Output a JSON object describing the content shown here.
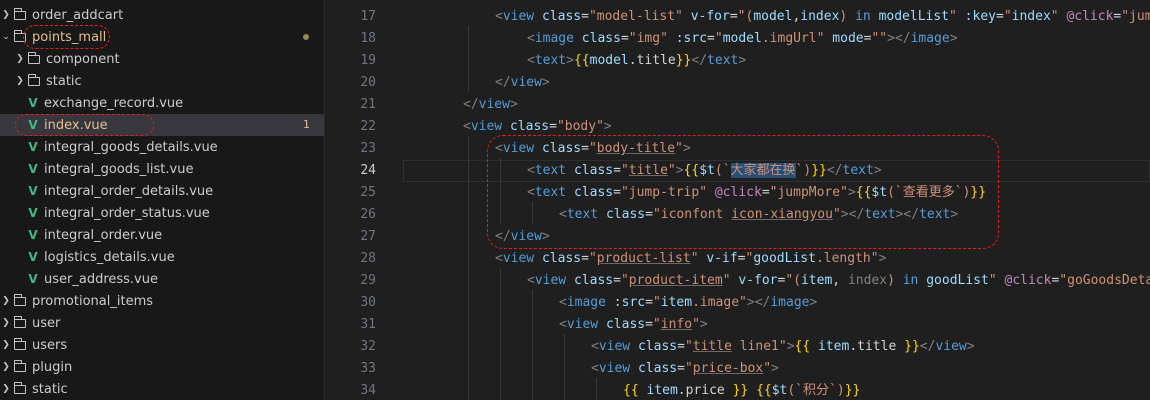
{
  "explorer": {
    "items": [
      {
        "label": "order_addcart",
        "kind": "folder",
        "expanded": false
      },
      {
        "label": "points_mall",
        "kind": "folder",
        "expanded": true,
        "modified": true
      },
      {
        "label": "component",
        "kind": "folder",
        "expanded": false
      },
      {
        "label": "static",
        "kind": "folder",
        "expanded": false
      },
      {
        "label": "exchange_record.vue",
        "kind": "vue"
      },
      {
        "label": "index.vue",
        "kind": "vue",
        "selected": true,
        "problem_count": "1"
      },
      {
        "label": "integral_goods_details.vue",
        "kind": "vue"
      },
      {
        "label": "integral_goods_list.vue",
        "kind": "vue"
      },
      {
        "label": "integral_order_details.vue",
        "kind": "vue"
      },
      {
        "label": "integral_order_status.vue",
        "kind": "vue"
      },
      {
        "label": "integral_order.vue",
        "kind": "vue"
      },
      {
        "label": "logistics_details.vue",
        "kind": "vue"
      },
      {
        "label": "user_address.vue",
        "kind": "vue"
      },
      {
        "label": "promotional_items",
        "kind": "folder",
        "expanded": false
      },
      {
        "label": "user",
        "kind": "folder",
        "expanded": false
      },
      {
        "label": "users",
        "kind": "folder",
        "expanded": false
      },
      {
        "label": "plugin",
        "kind": "folder",
        "expanded": false
      },
      {
        "label": "static",
        "kind": "folder",
        "expanded": false
      }
    ]
  },
  "editor": {
    "current_line": "24",
    "line_numbers": [
      "17",
      "18",
      "19",
      "20",
      "21",
      "22",
      "23",
      "24",
      "25",
      "26",
      "27",
      "28",
      "29",
      "30",
      "31",
      "32",
      "33",
      "34"
    ],
    "code": {
      "l17": {
        "open": "<",
        "tag": "view",
        "a1": "class",
        "s1": "\"model-list\"",
        "a2": "v-for",
        "s2a": "\"(",
        "v2a": "model",
        "s2b": ",",
        "v2b": "index",
        "s2c": ") ",
        "k2": "in",
        "s2d": " ",
        "v2c": "modelList",
        "s2e": "\"",
        "a3": ":key",
        "s3a": "\"",
        "v3": "index",
        "s3b": "\"",
        "a4": "@click",
        "s4": "\"jump"
      },
      "l18": {
        "open": "<",
        "tag": "image",
        "a1": "class",
        "s1": "\"img\"",
        "a2": ":src",
        "s2a": "\"",
        "v2a": "model",
        "s2b": ".imgUrl\"",
        "a3": "mode",
        "s3": "\"\"",
        "close_a": "></",
        "tag2": "image",
        "close_b": ">"
      },
      "l19": {
        "open": "<",
        "tag": "text",
        "close_a": ">",
        "b1": "{{",
        "v1": "model",
        "s1": ".title",
        "b2": "}}",
        "close_b": "</",
        "tag2": "text",
        "close_c": ">"
      },
      "l20": {
        "open": "</",
        "tag": "view",
        "close": ">"
      },
      "l21": {
        "open": "</",
        "tag": "view",
        "close": ">"
      },
      "l22": {
        "open": "<",
        "tag": "view",
        "a1": "class",
        "s1": "\"body\"",
        "close": ">"
      },
      "l23": {
        "open": "<",
        "tag": "view",
        "a1": "class",
        "s1q": "\"",
        "s1": "body-title",
        "s1e": "\"",
        "close": ">"
      },
      "l24": {
        "open": "<",
        "tag": "text",
        "a1": "class",
        "s1q": "\"",
        "s1": "title",
        "s1e": "\"",
        "close_a": ">",
        "b1": "{{",
        "f": "$t",
        "p1": "(`",
        "hl": "大家都在换",
        "p2": "`)",
        "b2": "}}",
        "close_b": "</",
        "tag2": "text",
        "close_c": ">"
      },
      "l25": {
        "open": "<",
        "tag": "text",
        "a1": "class",
        "s1": "\"jump-trip\"",
        "a2": "@click",
        "s2": "\"jumpMore\"",
        "close_a": ">",
        "b1": "{{",
        "f": "$t",
        "p1": "(`",
        "txt": "查看更多",
        "p2": "`)",
        "b2": "}}"
      },
      "l26": {
        "open": "<",
        "tag": "text",
        "a1": "class",
        "s1q": "\"iconfont ",
        "s1": "icon-xiangyou",
        "s1e": "\"",
        "close_a": "></",
        "tag2": "text",
        "close_b": "></",
        "tag3": "text",
        "close_c": ">"
      },
      "l27": {
        "open": "</",
        "tag": "view",
        "close": ">"
      },
      "l28": {
        "open": "<",
        "tag": "view",
        "a1": "class",
        "s1q": "\"",
        "s1": "product-list",
        "s1e": "\"",
        "a2": "v-if",
        "s2a": "\"",
        "v2": "goodList",
        "s2b": ".length\"",
        "close": ">"
      },
      "l29": {
        "open": "<",
        "tag": "view",
        "a1": "class",
        "s1q": "\"",
        "s1": "product-item",
        "s1e": "\"",
        "a2": "v-for",
        "s2a": "\"(",
        "v2a": "item",
        "s2b": ", ",
        "v2b": "index",
        "s2c": ") ",
        "k2": "in",
        "s2d": " ",
        "v2c": "goodList",
        "s2e": "\"",
        "a3": "@click",
        "s3": "\"goGoodsDeta"
      },
      "l30": {
        "open": "<",
        "tag": "image",
        "a1": ":src",
        "s1a": "\"",
        "v1": "item",
        "s1b": ".image\"",
        "close_a": "></",
        "tag2": "image",
        "close_b": ">"
      },
      "l31": {
        "open": "<",
        "tag": "view",
        "a1": "class",
        "s1q": "\"",
        "s1": "info",
        "s1e": "\"",
        "close": ">"
      },
      "l32": {
        "open": "<",
        "tag": "view",
        "a1": "class",
        "s1q": "\"",
        "s1": "title",
        "s1e": "\"",
        "s1t": " line1\"",
        "close_a": ">",
        "b1": "{{",
        "sp1": " ",
        "v1": "item",
        "s2": ".title ",
        "b2": "}}",
        "close_b": "</",
        "tag2": "view",
        "close_c": ">"
      },
      "l33": {
        "open": "<",
        "tag": "view",
        "a1": "class",
        "s1q": "\"",
        "s1": "price-box",
        "s1e": "\"",
        "close": ">"
      },
      "l34": {
        "b1": "{{",
        "sp1": " ",
        "v1": "item",
        "s1": ".price ",
        "b2": "}}",
        "sp2": " ",
        "b3": "{{",
        "f": "$t",
        "p1": "(`",
        "txt": "积分",
        "p2": "`)",
        "b4": "}}"
      }
    }
  }
}
